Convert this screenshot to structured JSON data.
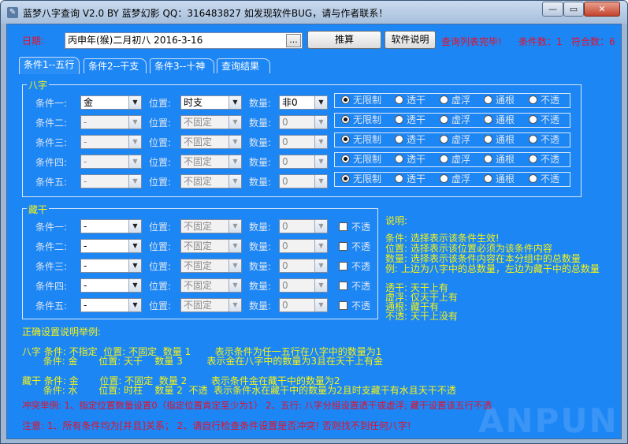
{
  "window": {
    "title": "蓝梦八字查询 V2.0 BY 蓝梦幻影 QQ：316483827 如发现软件BUG，请与作者联系！",
    "controls": {
      "min": "—",
      "max": "▭",
      "close": "✕"
    }
  },
  "top": {
    "date_label": "日期:",
    "date_value": "丙申年(猴)二月初八  2016-3-16",
    "date_btn": "...",
    "calc_btn": "推算",
    "help_btn": "软件说明",
    "status": "查询列表完毕!",
    "cond_count": "条件数：1",
    "match_count": "符合数：6"
  },
  "tabs": [
    "条件1--五行",
    "条件2--干支",
    "条件3--十神",
    "查询结果"
  ],
  "bazi": {
    "legend": "八字",
    "pos_label": "位置:",
    "num_label": "数量:",
    "radio_options": [
      "无限制",
      "透干",
      "虚浮",
      "通根",
      "不透"
    ],
    "rows": [
      {
        "label": "条件一:",
        "element": "金",
        "position": "时支",
        "count": "非0",
        "selected": 0
      },
      {
        "label": "条件二:",
        "element": "-",
        "position": "不固定",
        "count": "0",
        "selected": 0
      },
      {
        "label": "条件三:",
        "element": "-",
        "position": "不固定",
        "count": "0",
        "selected": 0
      },
      {
        "label": "条件四:",
        "element": "-",
        "position": "不固定",
        "count": "0",
        "selected": 0
      },
      {
        "label": "条件五:",
        "element": "-",
        "position": "不固定",
        "count": "0",
        "selected": 0
      }
    ]
  },
  "canggan": {
    "legend": "藏干",
    "pos_label": "位置:",
    "num_label": "数量:",
    "check_label": "不透",
    "rows": [
      {
        "label": "条件一:",
        "element": "-",
        "position": "不固定",
        "count": "0"
      },
      {
        "label": "条件二:",
        "element": "-",
        "position": "不固定",
        "count": "0"
      },
      {
        "label": "条件三:",
        "element": "-",
        "position": "不固定",
        "count": "0"
      },
      {
        "label": "条件四:",
        "element": "-",
        "position": "不固定",
        "count": "0"
      },
      {
        "label": "条件五:",
        "element": "-",
        "position": "不固定",
        "count": "0"
      }
    ]
  },
  "explain": {
    "title": "说明:",
    "lines": [
      "条件: 选择表示该条件生效!",
      "位置: 选择表示该位置必须为该条件内容",
      "数量: 选择表示该条件内容在本分组中的总数量",
      "例: 上边为八字中的总数量，左边为藏干中的总数量"
    ],
    "lines2": [
      "透干: 天干上有",
      "虚浮: 仅天干上有",
      "通根: 藏干有",
      "不透: 天干上没有"
    ]
  },
  "examples": {
    "title": "正确设置说明举例:",
    "bazi_lines": [
      "八字 条件: 不指定  位置: 不固定  数量 1        表示条件为任一五行在八字中的数量为1",
      "       条件: 金       位置: 天干    数量 3        表示金在八字中的数量为3且在天干上有金"
    ],
    "canggan_lines": [
      "藏干 条件: 金       位置: 不固定  数量 2        表示条件金在藏干中的数量为2",
      "       条件: 水       位置: 时柱    数量 2  不透  表示条件水在藏干中的数量为2且时支藏干有水且天干不透"
    ],
    "conflict": "冲突举例: 1、指定位置数量设置0（指定位置肯定至少为1）  2、五行: 八字分组设置透干或虚浮; 藏干设置该五行不透",
    "note": "注意: 1、所有条件均为[并且]关系；    2、请自行检查条件设置是否冲突! 否则找不到任何八字!"
  },
  "watermark": "ANPUN",
  "colors": {
    "panel": "#1d86f5",
    "title_bar": "#b7cbe4",
    "red_text": "#e4102a",
    "yellow_text": "#f3f316"
  }
}
